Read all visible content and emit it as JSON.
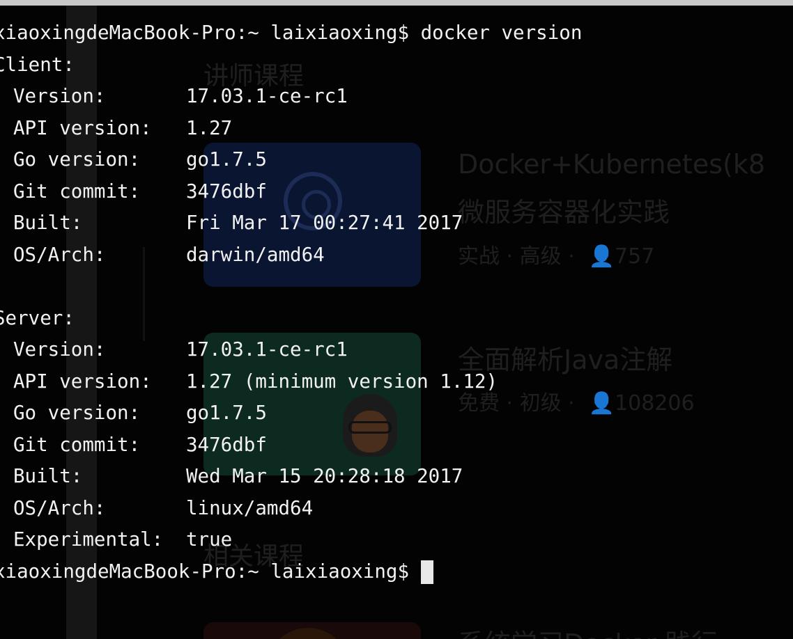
{
  "background_ghost": {
    "heading_1": "讲师课程",
    "heading_2": "相关课程",
    "course_1": {
      "title_line_1": "Docker+Kubernetes(k8",
      "title_line_2": "微服务容器化实践",
      "meta": "实战 · 高级 ·",
      "users": "757"
    },
    "course_2": {
      "title": "全面解析Java注解",
      "meta": "免费 · 初级 ·",
      "users": "108206"
    },
    "course_3": {
      "title_partial": "系统学习Docker 践行"
    }
  },
  "terminal": {
    "prompt": "xiaoxingdeMacBook-Pro:~ laixiaoxing$",
    "command": "docker version",
    "client_header": "Client:",
    "client": [
      {
        "key": "Version:",
        "value": "17.03.1-ce-rc1"
      },
      {
        "key": "API version:",
        "value": "1.27"
      },
      {
        "key": "Go version:",
        "value": "go1.7.5"
      },
      {
        "key": "Git commit:",
        "value": "3476dbf"
      },
      {
        "key": "Built:",
        "value": "Fri Mar 17 00:27:41 2017"
      },
      {
        "key": "OS/Arch:",
        "value": "darwin/amd64"
      }
    ],
    "server_header": "Server:",
    "server": [
      {
        "key": "Version:",
        "value": "17.03.1-ce-rc1"
      },
      {
        "key": "API version:",
        "value": "1.27 (minimum version 1.12)"
      },
      {
        "key": "Go version:",
        "value": "go1.7.5"
      },
      {
        "key": "Git commit:",
        "value": "3476dbf"
      },
      {
        "key": "Built:",
        "value": "Wed Mar 15 20:28:18 2017"
      },
      {
        "key": "OS/Arch:",
        "value": "linux/amd64"
      },
      {
        "key": "Experimental:",
        "value": "true"
      }
    ],
    "final_prompt": "xiaoxingdeMacBook-Pro:~ laixiaoxing$"
  }
}
